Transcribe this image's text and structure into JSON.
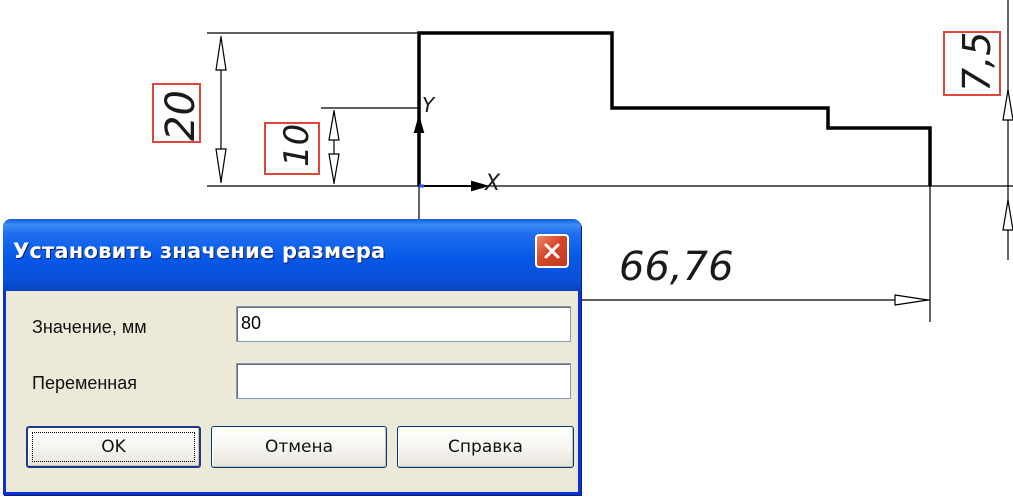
{
  "drawing": {
    "dim_height_total": "20",
    "dim_height_step": "10",
    "dim_right": "7,5",
    "dim_length": "66,76",
    "axis_y": "Y",
    "axis_x": "X"
  },
  "dialog": {
    "title": "Установить значение размера",
    "value_label": "Значение, мм",
    "value": "80",
    "variable_label": "Переменная",
    "variable_value": "",
    "ok_label": "OK",
    "cancel_label": "Отмена",
    "help_label": "Справка",
    "close_icon": "close-icon"
  },
  "colors": {
    "titlebar": "#0558e8",
    "dialog_bg": "#ece9d8",
    "dimension_box": "#e0463c"
  }
}
